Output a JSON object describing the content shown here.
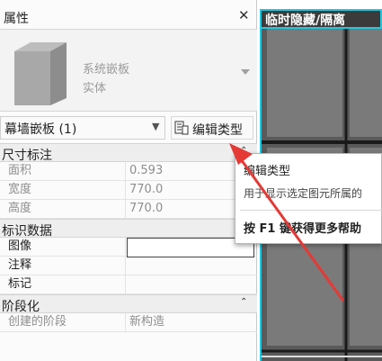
{
  "properties": {
    "title": "属性",
    "close_icon": "close-icon",
    "type_selector": {
      "name": "系统嵌板",
      "sub": "实体",
      "thumbnail_icon": "panel-3d-icon"
    },
    "instance_selector": {
      "label": "幕墙嵌板 (1)"
    },
    "edit_type_button": {
      "label": "编辑类型",
      "icon": "edit-type-icon"
    },
    "groups": [
      {
        "label": "尺寸标注",
        "collapsible": true,
        "rows": [
          {
            "key": "面积",
            "value": "0.593",
            "read_only": true
          },
          {
            "key": "宽度",
            "value": "770.0",
            "read_only": true
          },
          {
            "key": "高度",
            "value": "770.0",
            "read_only": true
          }
        ]
      },
      {
        "label": "标识数据",
        "collapsible": false,
        "rows": [
          {
            "key": "图像",
            "value": "",
            "read_only": false,
            "active": true
          },
          {
            "key": "注释",
            "value": "",
            "read_only": false
          },
          {
            "key": "标记",
            "value": "",
            "read_only": false
          }
        ]
      },
      {
        "label": "阶段化",
        "collapsible": true,
        "rows": [
          {
            "key": "创建的阶段",
            "value": "新构造",
            "read_only": true
          }
        ]
      }
    ]
  },
  "view": {
    "title": "临时隐藏/隔离"
  },
  "tooltip": {
    "title": "编辑类型",
    "description": "用于显示选定图元所属的",
    "help": "按 F1 键获得更多帮助"
  },
  "colors": {
    "view_border": "#20c8e0",
    "view_tab_bg": "#3b3b3b",
    "arrow": "#e53935",
    "panel_fill": "#7a7a7a"
  }
}
